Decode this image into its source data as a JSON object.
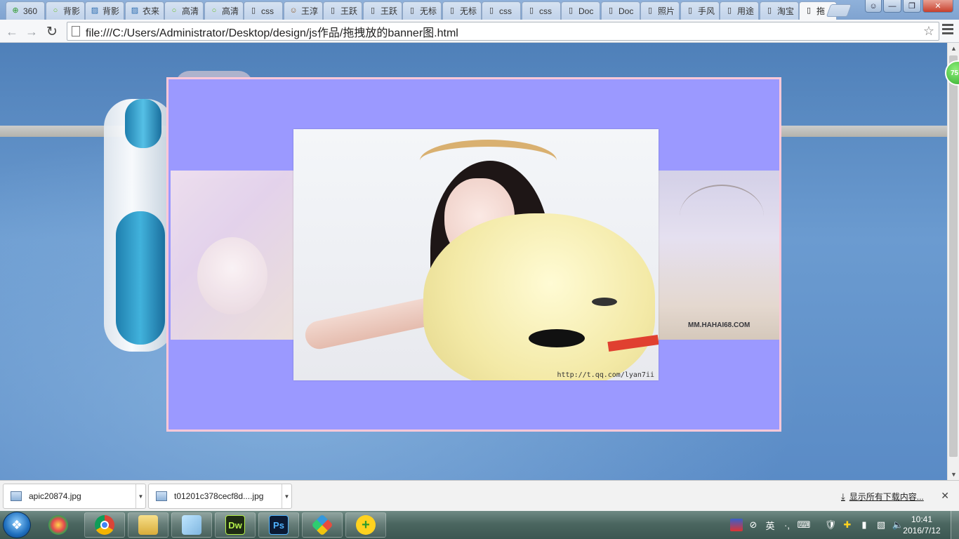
{
  "tabs": [
    {
      "label": "360",
      "icon": "360-browser-icon"
    },
    {
      "label": "背影",
      "icon": "loading-circle-icon"
    },
    {
      "label": "背影",
      "icon": "bookmark-app-icon"
    },
    {
      "label": "衣来",
      "icon": "bookmark-app-icon"
    },
    {
      "label": "高清",
      "icon": "loading-circle-icon"
    },
    {
      "label": "高清",
      "icon": "loading-circle-icon"
    },
    {
      "label": "css",
      "icon": "page-icon"
    },
    {
      "label": "王淳",
      "icon": "face-icon"
    },
    {
      "label": "王跃",
      "icon": "page-icon"
    },
    {
      "label": "王跃",
      "icon": "page-icon"
    },
    {
      "label": "无标",
      "icon": "page-icon"
    },
    {
      "label": "无标",
      "icon": "page-icon"
    },
    {
      "label": "css",
      "icon": "page-icon"
    },
    {
      "label": "css",
      "icon": "page-icon"
    },
    {
      "label": "Doc",
      "icon": "page-icon"
    },
    {
      "label": "Doc",
      "icon": "page-icon"
    },
    {
      "label": "照片",
      "icon": "page-icon"
    },
    {
      "label": "手风",
      "icon": "page-icon"
    },
    {
      "label": "用途",
      "icon": "page-icon"
    },
    {
      "label": "淘宝",
      "icon": "page-icon"
    },
    {
      "label": "拖",
      "icon": "page-icon",
      "active": true
    }
  ],
  "toolbar": {
    "url": "file:///C:/Users/Administrator/Desktop/design/js作品/拖拽放的banner图.html"
  },
  "page": {
    "badge": "75",
    "banner_bg": "#9b99ff",
    "banner_border": "#ffc8d8",
    "left_watermark": "",
    "right_watermark": "MM.HAHAI68.COM",
    "center_watermark": "http://t.qq.com/lyan7ii"
  },
  "downloads": {
    "items": [
      {
        "name": "apic20874.jpg"
      },
      {
        "name": "t01201c378cecf8d....jpg"
      }
    ],
    "show_all": "显示所有下载内容..."
  },
  "taskbar": {
    "apps": [
      {
        "label": "",
        "icon": "chrome-icon"
      },
      {
        "label": "",
        "icon": "folder-icon"
      },
      {
        "label": "",
        "icon": "notepad-icon"
      },
      {
        "label": "Dw",
        "icon": "dreamweaver-icon"
      },
      {
        "label": "Ps",
        "icon": "photoshop-icon"
      },
      {
        "label": "",
        "icon": "app-diamond-icon"
      },
      {
        "label": "",
        "icon": "360-plus-icon"
      }
    ],
    "ime": "英",
    "time": "10:41",
    "date": "2016/7/12"
  }
}
